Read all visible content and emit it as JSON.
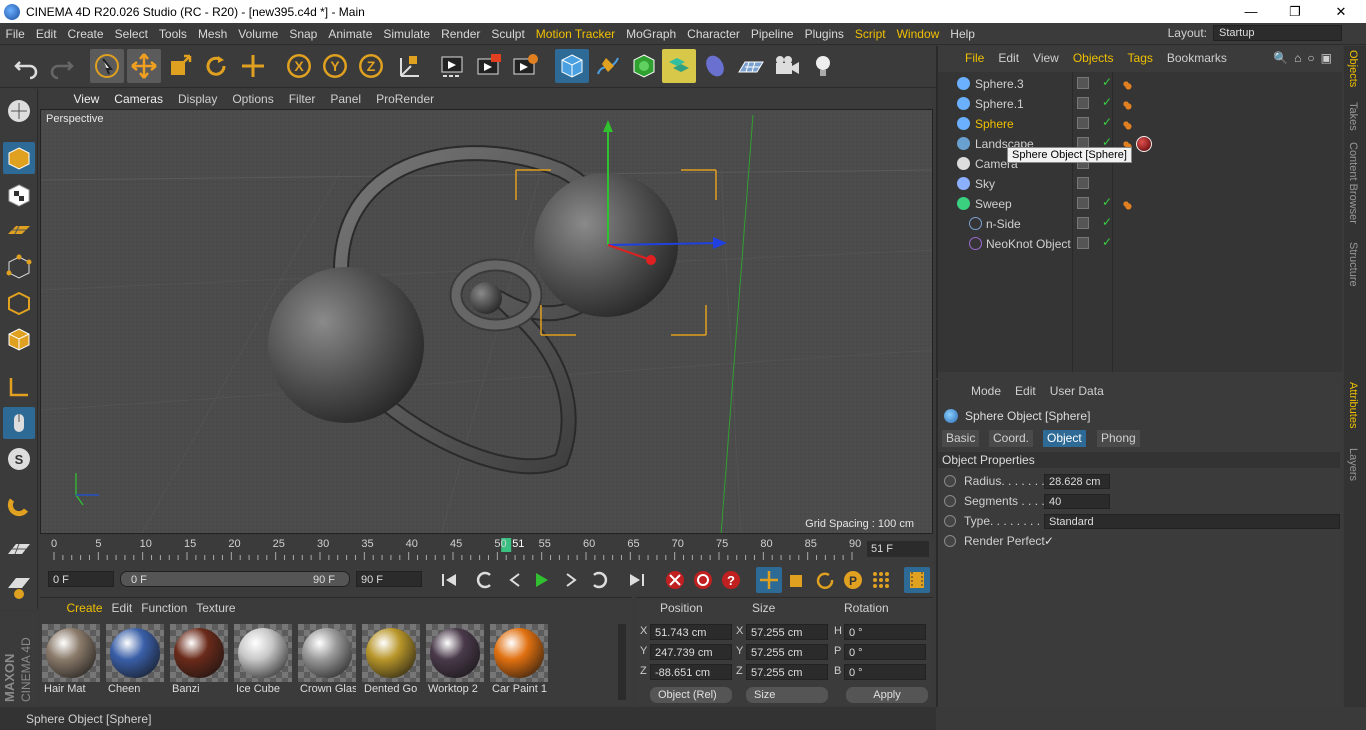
{
  "title": "CINEMA 4D R20.026 Studio (RC - R20) - [new395.c4d *] - Main",
  "window_controls": {
    "minimize": "—",
    "maximize": "❐",
    "close": "✕"
  },
  "menu": [
    "File",
    "Edit",
    "Create",
    "Select",
    "Tools",
    "Mesh",
    "Volume",
    "Snap",
    "Animate",
    "Simulate",
    "Render",
    "Sculpt",
    "Motion Tracker",
    "MoGraph",
    "Character",
    "Pipeline",
    "Plugins",
    "Script",
    "Window",
    "Help"
  ],
  "menu_highlight": [
    "Motion Tracker",
    "Script",
    "Window"
  ],
  "layout": {
    "label": "Layout:",
    "value": "Startup"
  },
  "viewport": {
    "menu": [
      "View",
      "Cameras",
      "Display",
      "Options",
      "Filter",
      "Panel",
      "ProRender"
    ],
    "label": "Perspective",
    "grid_spacing": "Grid Spacing : 100 cm"
  },
  "timeline": {
    "ticks": [
      "0",
      "5",
      "10",
      "15",
      "20",
      "25",
      "30",
      "35",
      "40",
      "45",
      "50",
      "55",
      "60",
      "65",
      "70",
      "75",
      "80",
      "85",
      "90"
    ],
    "current_frame": "51",
    "current_frame_field": "51 F",
    "current_value": 51,
    "max_frame": 90
  },
  "transport": {
    "start_field": "0 F",
    "range_left": "0 F",
    "range_right": "90 F",
    "end_field": "90 F"
  },
  "materials": {
    "menu": [
      "Create",
      "Edit",
      "Function",
      "Texture"
    ],
    "items": [
      {
        "name": "Hair Mat",
        "color": "#8a7a6a"
      },
      {
        "name": "Cheen",
        "color": "#3a5fa8"
      },
      {
        "name": "Banzi",
        "color": "#6a2a1a"
      },
      {
        "name": "Ice Cube",
        "color": "#c8c8c8"
      },
      {
        "name": "Crown Glas",
        "color": "#9a9a9a"
      },
      {
        "name": "Dented Go",
        "color": "#b8962a"
      },
      {
        "name": "Worktop 2",
        "color": "#4a3a4a"
      },
      {
        "name": "Car Paint 1",
        "color": "#e07010"
      }
    ]
  },
  "coords": {
    "headers": [
      "Position",
      "Size",
      "Rotation"
    ],
    "rows": [
      {
        "axis": "X",
        "pos": "51.743 cm",
        "size_axis": "X",
        "size": "57.255 cm",
        "rot_axis": "H",
        "rot": "0 °"
      },
      {
        "axis": "Y",
        "pos": "247.739 cm",
        "size_axis": "Y",
        "size": "57.255 cm",
        "rot_axis": "P",
        "rot": "0 °"
      },
      {
        "axis": "Z",
        "pos": "-88.651 cm",
        "size_axis": "Z",
        "size": "57.255 cm",
        "rot_axis": "B",
        "rot": "0 °"
      }
    ],
    "mode": "Object (Rel)",
    "size_mode": "Size",
    "apply": "Apply"
  },
  "status": "Sphere Object [Sphere]",
  "objects": {
    "menu": [
      "File",
      "Edit",
      "View",
      "Objects",
      "Tags",
      "Bookmarks"
    ],
    "items": [
      {
        "name": "Sphere.3",
        "indent": 0,
        "icon": "sphere-icon"
      },
      {
        "name": "Sphere.1",
        "indent": 0,
        "icon": "sphere-icon"
      },
      {
        "name": "Sphere",
        "indent": 0,
        "icon": "sphere-icon",
        "selected": true
      },
      {
        "name": "Landscape",
        "indent": 0,
        "icon": "landscape-icon"
      },
      {
        "name": "Camera",
        "indent": 0,
        "icon": "camera-icon"
      },
      {
        "name": "Sky",
        "indent": 0,
        "icon": "sky-icon"
      },
      {
        "name": "Sweep",
        "indent": 0,
        "icon": "sweep-icon"
      },
      {
        "name": "n-Side",
        "indent": 1,
        "icon": "nside-icon"
      },
      {
        "name": "NeoKnot Object",
        "indent": 1,
        "icon": "neoknot-icon"
      }
    ],
    "tooltip": "Sphere Object [Sphere]"
  },
  "attributes": {
    "menu": [
      "Mode",
      "Edit",
      "User Data"
    ],
    "object_title": "Sphere Object [Sphere]",
    "tabs": [
      "Basic",
      "Coord.",
      "Object",
      "Phong"
    ],
    "active_tab": "Object",
    "section": "Object Properties",
    "props": [
      {
        "label": "Radius. . . . . . .",
        "value": "28.628 cm"
      },
      {
        "label": "Segments . . . .",
        "value": "40"
      },
      {
        "label": "Type. . . . . . . . .",
        "value": "Standard"
      },
      {
        "label": "Render Perfect",
        "value": "✓"
      }
    ]
  },
  "side_tabs": [
    "Objects",
    "Takes",
    "Content Browser",
    "Structure",
    "Attributes",
    "Layers"
  ],
  "brand": "MAXON CINEMA 4D",
  "colors": {
    "accent": "#2d6a96",
    "highlight": "#f0c000",
    "panel": "#3b3b3b"
  }
}
